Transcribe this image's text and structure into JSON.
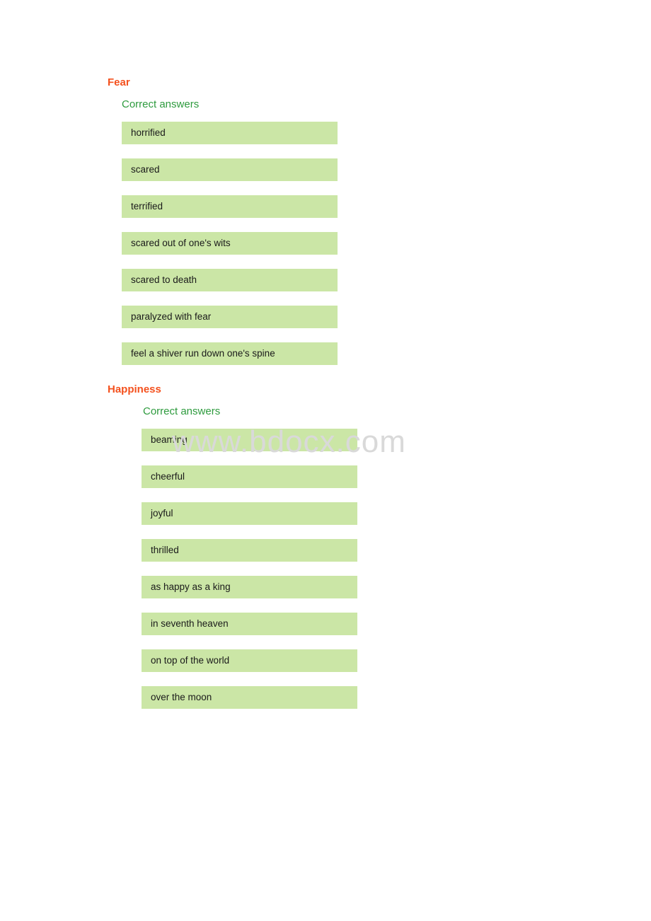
{
  "watermark": {
    "text": "www.bdocx.com"
  },
  "colors": {
    "heading": "#f4511e",
    "subheading": "#2e9b3e",
    "answer_background": "#cbe6a6",
    "answer_text": "#1a1a1a",
    "page_background": "#ffffff",
    "watermark": "#d9d9d9"
  },
  "sections": [
    {
      "title": "Fear",
      "subtitle": "Correct answers",
      "answers": [
        "horrified",
        "scared",
        "terrified",
        "scared out of one's wits",
        "scared to death",
        "paralyzed with fear",
        "feel a shiver run down one's spine"
      ]
    },
    {
      "title": "Happiness",
      "subtitle": "Correct answers",
      "answers": [
        "beaming",
        "cheerful",
        "joyful",
        "thrilled",
        "as happy as a king",
        "in seventh heaven",
        "on top of the world",
        "over the moon"
      ]
    }
  ]
}
